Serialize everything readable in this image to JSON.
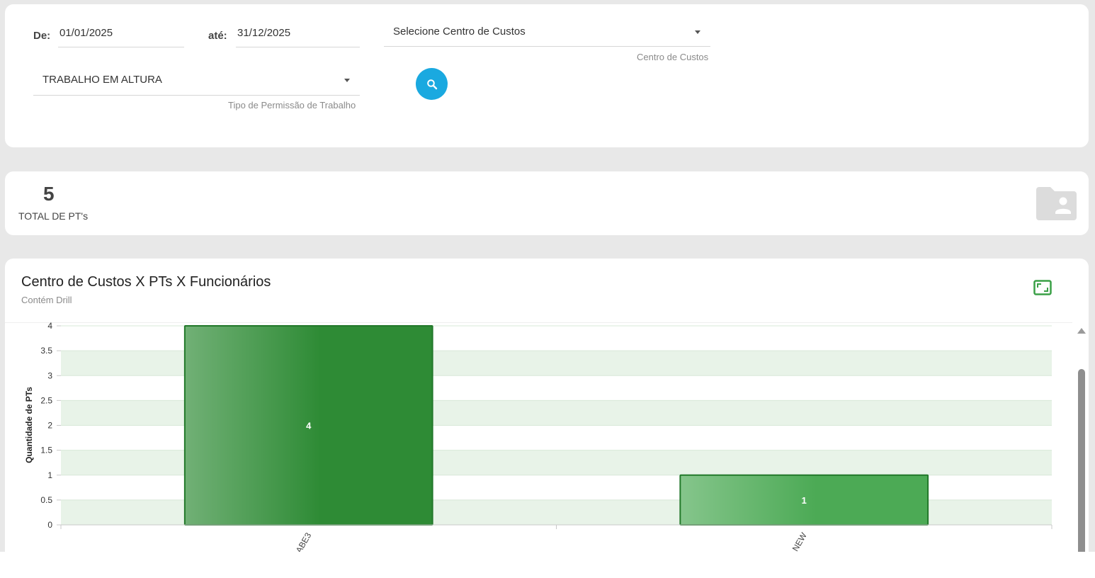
{
  "filters": {
    "from_label": "De:",
    "from_value": "01/01/2025",
    "to_label": "até:",
    "to_value": "31/12/2025",
    "cost_center_value": "Selecione Centro de Custos",
    "cost_center_hint": "Centro de Custos",
    "permit_type_value": "TRABALHO EM ALTURA",
    "permit_type_hint": "Tipo de Permissão de Trabalho",
    "search_icon": "search-icon"
  },
  "summary": {
    "total_value": "5",
    "total_label": "TOTAL DE PT's",
    "icon": "folder-person-icon"
  },
  "chart_card": {
    "title": "Centro de Custos X PTs X Funcionários",
    "subtitle": "Contém Drill",
    "expand_icon": "expand-icon"
  },
  "chart_data": {
    "type": "bar",
    "categories": [
      "ABE3",
      "NEW"
    ],
    "values": [
      4,
      1
    ],
    "data_labels": [
      "4",
      "1"
    ],
    "xlabel": "",
    "ylabel": "Quantidade de PTs",
    "ylim": [
      0,
      4
    ],
    "yticks": [
      "0",
      "0.5",
      "1",
      "1.5",
      "2",
      "2.5",
      "3",
      "3.5",
      "4"
    ],
    "grid": true,
    "bar_color": "#2e8b35",
    "band_color": "#e8f3e8"
  }
}
